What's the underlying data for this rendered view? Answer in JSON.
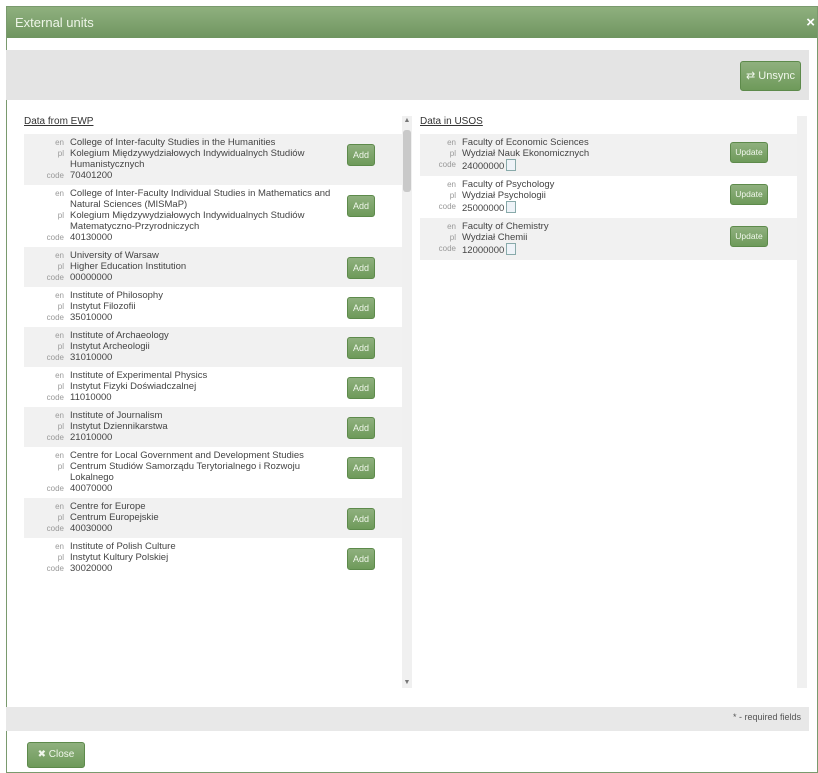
{
  "dialog": {
    "title": "External units",
    "close_glyph": "×"
  },
  "toolbar": {
    "unsync_label": "⇄ Unsync"
  },
  "left": {
    "title": "Data from EWP",
    "add_label": "Add",
    "items": [
      {
        "en": "College of Inter-faculty Studies in the Humanities",
        "pl": "Kolegium Międzywydziałowych Indywidualnych Studiów Humanistycznych",
        "code": "70401200"
      },
      {
        "en": "College of Inter-Faculty Individual Studies in Mathematics and Natural Sciences (MISMaP)",
        "pl": "Kolegium Międzywydziałowych Indywidualnych Studiów Matematyczno-Przyrodniczych",
        "code": "40130000"
      },
      {
        "en": "University of Warsaw",
        "pl": "Higher Education Institution",
        "code": "00000000"
      },
      {
        "en": "Institute of Philosophy",
        "pl": "Instytut Filozofii",
        "code": "35010000"
      },
      {
        "en": "Institute of Archaeology",
        "pl": "Instytut Archeologii",
        "code": "31010000"
      },
      {
        "en": "Institute of Experimental Physics",
        "pl": "Instytut Fizyki Doświadczalnej",
        "code": "11010000"
      },
      {
        "en": "Institute of Journalism",
        "pl": "Instytut Dziennikarstwa",
        "code": "21010000"
      },
      {
        "en": "Centre for Local Government and Development Studies",
        "pl": "Centrum Studiów Samorządu Terytorialnego i Rozwoju Lokalnego",
        "code": "40070000"
      },
      {
        "en": "Centre for Europe",
        "pl": "Centrum Europejskie",
        "code": "40030000"
      },
      {
        "en": "Institute of Polish Culture",
        "pl": "Instytut Kultury Polskiej",
        "code": "30020000"
      }
    ]
  },
  "right": {
    "title": "Data in USOS",
    "update_label": "Update",
    "items": [
      {
        "en": "Faculty of Economic Sciences",
        "pl": "Wydział Nauk Ekonomicznych",
        "code": "24000000"
      },
      {
        "en": "Faculty of Psychology",
        "pl": "Wydział Psychologii",
        "code": "25000000"
      },
      {
        "en": "Faculty of Chemistry",
        "pl": "Wydział Chemii",
        "code": "12000000"
      }
    ]
  },
  "labels": {
    "en": "en",
    "pl": "pl",
    "code": "code"
  },
  "footer": {
    "required_note": "* - required fields",
    "close_label": "✖ Close"
  },
  "colors": {
    "accent": "#7aa067",
    "titlebar": "#7fa26d"
  },
  "icons": [
    "close-icon",
    "unsync-icon",
    "document-icon"
  ]
}
